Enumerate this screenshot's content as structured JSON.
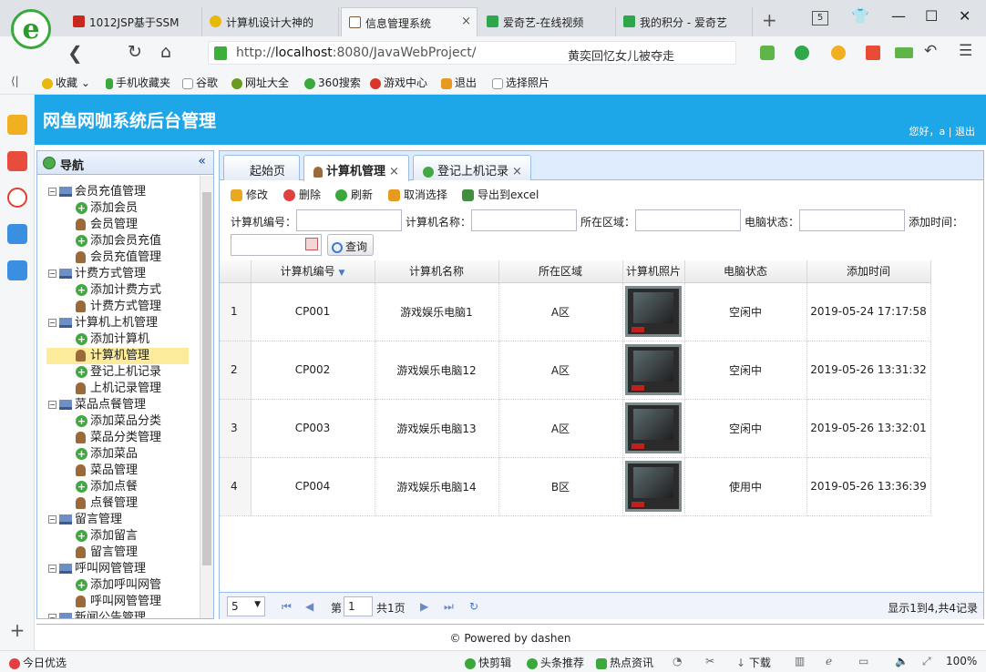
{
  "browser": {
    "tabs": [
      {
        "label": "1012JSP基于SSM",
        "color": "#c8281e"
      },
      {
        "label": "计算机设计大神的",
        "color": "#e8b80c"
      },
      {
        "label": "信息管理系统",
        "color": "#7a5c3a"
      },
      {
        "label": "爱奇艺-在线视频",
        "color": "#2fa64a"
      },
      {
        "label": "我的积分 - 爱奇艺",
        "color": "#2fa64a"
      }
    ],
    "tab_count": "5",
    "url_host": "http://",
    "url_bold": "localhost",
    "url_rest": ":8080/JavaWebProject/",
    "search_text": "黄奕回忆女儿被夺走",
    "bookmarks": [
      "收藏",
      "手机收藏夹",
      "谷歌",
      "网址大全",
      "360搜索",
      "游戏中心",
      "退出",
      "选择照片"
    ]
  },
  "app": {
    "title": "网鱼网咖系统后台管理",
    "greeting": "您好，a",
    "logout": "退出",
    "accent": "#1da7e8"
  },
  "nav": {
    "title": "导航",
    "groups": [
      {
        "label": "会员充值管理",
        "items": [
          {
            "label": "添加会员",
            "type": "add"
          },
          {
            "label": "会员管理",
            "type": "user"
          },
          {
            "label": "添加会员充值",
            "type": "add"
          },
          {
            "label": "会员充值管理",
            "type": "user"
          }
        ]
      },
      {
        "label": "计费方式管理",
        "items": [
          {
            "label": "添加计费方式",
            "type": "add"
          },
          {
            "label": "计费方式管理",
            "type": "user"
          }
        ]
      },
      {
        "label": "计算机上机管理",
        "items": [
          {
            "label": "添加计算机",
            "type": "add"
          },
          {
            "label": "计算机管理",
            "type": "user",
            "selected": true
          },
          {
            "label": "登记上机记录",
            "type": "add"
          },
          {
            "label": "上机记录管理",
            "type": "user"
          }
        ]
      },
      {
        "label": "菜品点餐管理",
        "items": [
          {
            "label": "添加菜品分类",
            "type": "add"
          },
          {
            "label": "菜品分类管理",
            "type": "user"
          },
          {
            "label": "添加菜品",
            "type": "add"
          },
          {
            "label": "菜品管理",
            "type": "user"
          },
          {
            "label": "添加点餐",
            "type": "add"
          },
          {
            "label": "点餐管理",
            "type": "user"
          }
        ]
      },
      {
        "label": "留言管理",
        "items": [
          {
            "label": "添加留言",
            "type": "add"
          },
          {
            "label": "留言管理",
            "type": "user"
          }
        ]
      },
      {
        "label": "呼叫网管管理",
        "items": [
          {
            "label": "添加呼叫网管",
            "type": "add"
          },
          {
            "label": "呼叫网管管理",
            "type": "user"
          }
        ]
      },
      {
        "label": "新闻公告管理",
        "items": []
      }
    ]
  },
  "main": {
    "tabs": [
      "起始页",
      "计算机管理",
      "登记上机记录"
    ],
    "toolbar": [
      "修改",
      "删除",
      "刷新",
      "取消选择",
      "导出到excel"
    ],
    "filters": {
      "code": "计算机编号：",
      "name": "计算机名称：",
      "area": "所在区域：",
      "state": "电脑状态：",
      "time": "添加时间：",
      "query": "查询"
    },
    "columns": [
      "计算机编号",
      "计算机名称",
      "所在区域",
      "计算机照片",
      "电脑状态",
      "添加时间"
    ],
    "rows": [
      {
        "n": "1",
        "code": "CP001",
        "name": "游戏娱乐电脑1",
        "area": "A区",
        "state": "空闲中",
        "time": "2019-05-24 17:17:58"
      },
      {
        "n": "2",
        "code": "CP002",
        "name": "游戏娱乐电脑12",
        "area": "A区",
        "state": "空闲中",
        "time": "2019-05-26 13:31:32"
      },
      {
        "n": "3",
        "code": "CP003",
        "name": "游戏娱乐电脑13",
        "area": "A区",
        "state": "空闲中",
        "time": "2019-05-26 13:32:01"
      },
      {
        "n": "4",
        "code": "CP004",
        "name": "游戏娱乐电脑14",
        "area": "B区",
        "state": "使用中",
        "time": "2019-05-26 13:36:39"
      }
    ],
    "pager": {
      "page_size": "5",
      "page_label": "第",
      "page_value": "1",
      "total_pages": "共1页",
      "summary": "显示1到4,共4记录"
    }
  },
  "footer": "© Powered by dashen",
  "statusbar": {
    "left": "今日优选",
    "items": [
      "快剪辑",
      "头条推荐",
      "热点资讯",
      "下载"
    ],
    "zoom": "100%"
  }
}
